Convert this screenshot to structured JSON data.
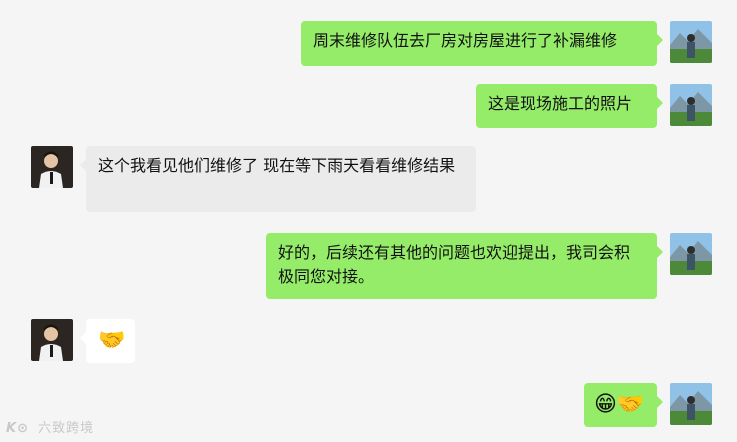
{
  "messages": [
    {
      "sender": "me",
      "text": "周末维修队伍去厂房对房屋进行了补漏维修"
    },
    {
      "sender": "me",
      "text": "这是现场施工的照片"
    },
    {
      "sender": "other",
      "text": "这个我看见他们维修了   现在等下雨天看看维修结果"
    },
    {
      "sender": "me",
      "text": "好的，后续还有其他的问题也欢迎提出，我司会积极同您对接。"
    },
    {
      "sender": "other",
      "text": "🤝"
    },
    {
      "sender": "me",
      "text": "😁🤝"
    }
  ],
  "avatars": {
    "me": "avatar-icon-mountain-landscape",
    "other": "avatar-icon-person"
  },
  "watermark": {
    "text": "六致跨境"
  },
  "colors": {
    "me_bubble": "#95ec69",
    "other_bubble": "#ebebeb",
    "background": "#f5f5f5"
  }
}
